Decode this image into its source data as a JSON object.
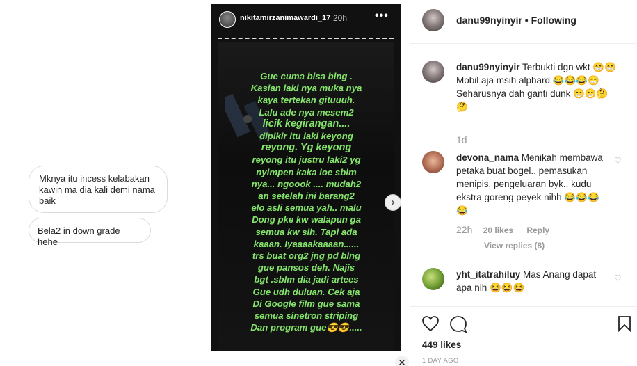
{
  "chat": {
    "bubble1": "Mknya itu incess kelabakan kawin ma dia kali demi nama baik",
    "bubble2": "Bela2 in down grade hehe"
  },
  "story": {
    "username": "nikitamirzanimawardi_17",
    "time": "20h",
    "more_icon": "more-horizontal-icon",
    "lines": [
      "Gue cuma bisa blng .",
      "Kasian laki nya muka nya",
      "kaya tertekan gituuuh.",
      "Lalu ade nya mesem2",
      "licik kegirangan....",
      "dipikir itu laki keyong",
      "reyong. Yg keyong",
      "reyong itu justru laki2 yg",
      "nyimpen kaka loe sblm",
      "nya... ngoook .... mudah2",
      "an setelah ini barang2",
      "elo asli semua yah.. malu",
      "Dong pke kw walapun ga",
      "semua kw sih. Tapi ada",
      "kaaan. Iyaaaakaaaan......",
      "trs buat org2 jng pd blng",
      "gue pansos deh. Najis",
      "bgt .sblm dia jadi artees",
      "Gue udh duluan. Cek aja",
      "Di Google film gue sama",
      "semua sinetron striping",
      "Dan program gue😎😎....."
    ]
  },
  "nav": {
    "next_icon": "chevron-right-icon",
    "next_glyph": "›",
    "close_icon": "close-icon",
    "close_glyph": "✕"
  },
  "post": {
    "header": {
      "username": "danu99nyinyir",
      "separator": " • ",
      "follow_status": "Following"
    },
    "caption": {
      "username": "danu99nyinyir",
      "text": " Terbukti dgn wkt 😁😁 Mobil aja msih alphard 😂😂😂😁 Seharusnya dah ganti dunk 😁😁🤔🤔",
      "time": "1d"
    },
    "comments": [
      {
        "username": "devona_nama",
        "text": " Menikah membawa petaka buat bogel.. pemasukan menipis, pengeluaran byk.. kudu ekstra goreng peyek nihh 😂😂😂😂",
        "time": "22h",
        "likes": "20 likes",
        "reply": "Reply",
        "view_replies": "View replies (8)"
      },
      {
        "username": "yht_itatrahiluy",
        "text": " Mas Anang dapat apa nih 😆😆😆"
      }
    ],
    "likes": "449 likes",
    "date": "1 DAY AGO",
    "icons": [
      "heart-icon",
      "comment-icon",
      "bookmark-icon"
    ]
  }
}
